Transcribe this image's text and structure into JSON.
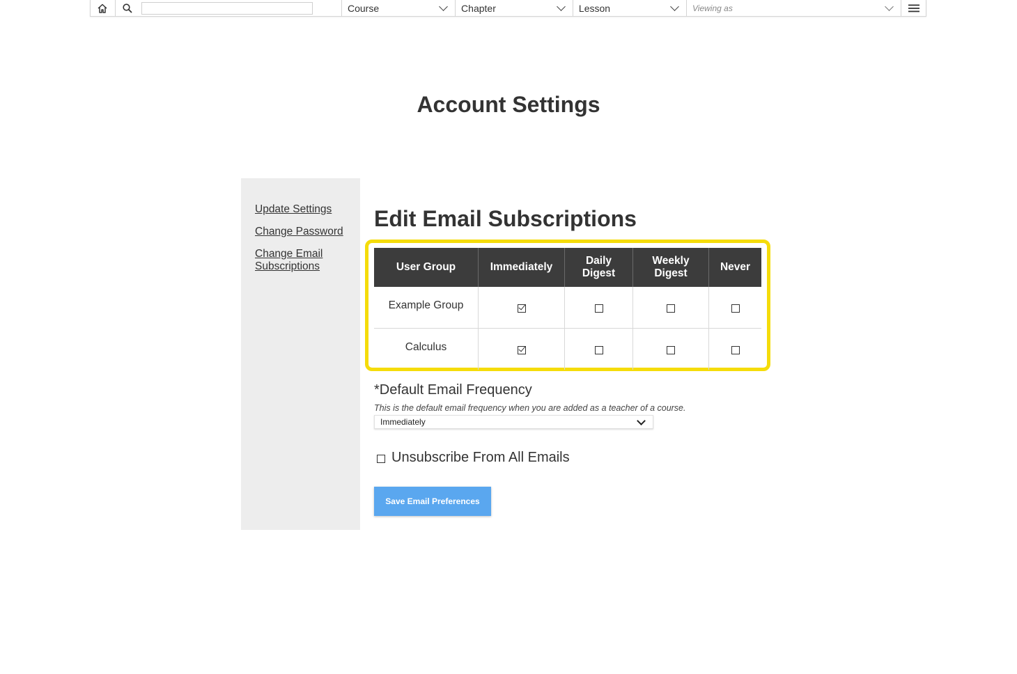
{
  "toolbar": {
    "home_icon": "home-icon",
    "search_icon": "search-icon",
    "search_value": "",
    "course_label": "Course",
    "chapter_label": "Chapter",
    "lesson_label": "Lesson",
    "viewing_as_placeholder": "Viewing as",
    "menu_icon": "hamburger-menu-icon"
  },
  "page": {
    "title": "Account Settings"
  },
  "sidebar": {
    "items": [
      {
        "label": "Update Settings"
      },
      {
        "label": "Change Password"
      },
      {
        "label": "Change Email Subscriptions"
      }
    ]
  },
  "main": {
    "section_title": "Edit Email Subscriptions",
    "highlight_color": "#f5dc0a",
    "table": {
      "headers": [
        "User Group",
        "Immediately",
        "Daily Digest",
        "Weekly Digest",
        "Never"
      ],
      "rows": [
        {
          "group": "Example Group",
          "selected": "Immediately"
        },
        {
          "group": "Calculus",
          "selected": "Immediately"
        }
      ]
    },
    "default_frequency": {
      "label": "*Default Email Frequency",
      "help": "This is the default email frequency when you are added as a teacher of a course.",
      "value": "Immediately"
    },
    "unsubscribe": {
      "label": "Unsubscribe From All Emails",
      "checked": false
    },
    "save_label": "Save Email Preferences",
    "accent_color": "#5aa7ef"
  }
}
